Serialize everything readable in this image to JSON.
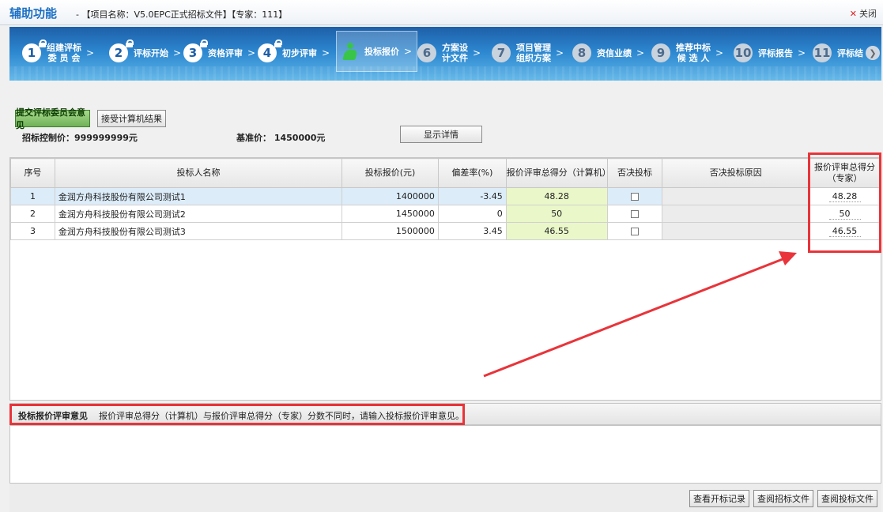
{
  "titlebar": {
    "app": "辅助功能",
    "project": "- 【项目名称：V5.0EPC正式招标文件】【专家：111】",
    "close_label": "关闭"
  },
  "steps": [
    {
      "num": "1",
      "label": "组建评标\n委 员 会",
      "locked": true
    },
    {
      "num": "2",
      "label": "评标开始",
      "locked": true
    },
    {
      "num": "3",
      "label": "资格评审",
      "locked": true
    },
    {
      "num": "4",
      "label": "初步评审",
      "locked": true
    },
    {
      "num": "",
      "label": "投标报价",
      "active": true
    },
    {
      "num": "6",
      "label": "方案设\n计文件"
    },
    {
      "num": "7",
      "label": "项目管理\n组织方案"
    },
    {
      "num": "8",
      "label": "资信业绩"
    },
    {
      "num": "9",
      "label": "推荐中标\n候 选 人"
    },
    {
      "num": "10",
      "label": "评标报告"
    },
    {
      "num": "11",
      "label": "评标结"
    }
  ],
  "actions": {
    "submit_label": "提交评标委员会意见",
    "accept_label": "接受计算机结果",
    "detail_label": "显示详情"
  },
  "info": {
    "control_price": "招标控制价：999999999元",
    "base_price": "基准价： 1450000元"
  },
  "table": {
    "headers": [
      "序号",
      "投标人名称",
      "投标报价(元)",
      "偏差率(%)",
      "报价评审总得分（计算机）",
      "否决投标",
      "否决投标原因",
      "报价评审总得分（专家）"
    ],
    "rows": [
      {
        "no": "1",
        "name": "金润方舟科技股份有限公司测试1",
        "price": "1400000",
        "dev": "-3.45",
        "score": "48.28",
        "reason": "",
        "expert": "48.28"
      },
      {
        "no": "2",
        "name": "金润方舟科技股份有限公司测试2",
        "price": "1450000",
        "dev": "0",
        "score": "50",
        "reason": "",
        "expert": "50"
      },
      {
        "no": "3",
        "name": "金润方舟科技股份有限公司测试3",
        "price": "1500000",
        "dev": "3.45",
        "score": "46.55",
        "reason": "",
        "expert": "46.55"
      }
    ]
  },
  "opinion": {
    "title": "投标报价评审意见",
    "message": "报价评审总得分（计算机）与报价评审总得分（专家）分数不同时，请输入投标报价评审意见。",
    "value": ""
  },
  "footer": {
    "btn_open_record": "查看开标记录",
    "btn_tender_doc": "查阅招标文件",
    "btn_bid_doc": "查阅投标文件"
  },
  "colors": {
    "highlight": "#e8343a",
    "step_bg": "#2c86cf"
  }
}
